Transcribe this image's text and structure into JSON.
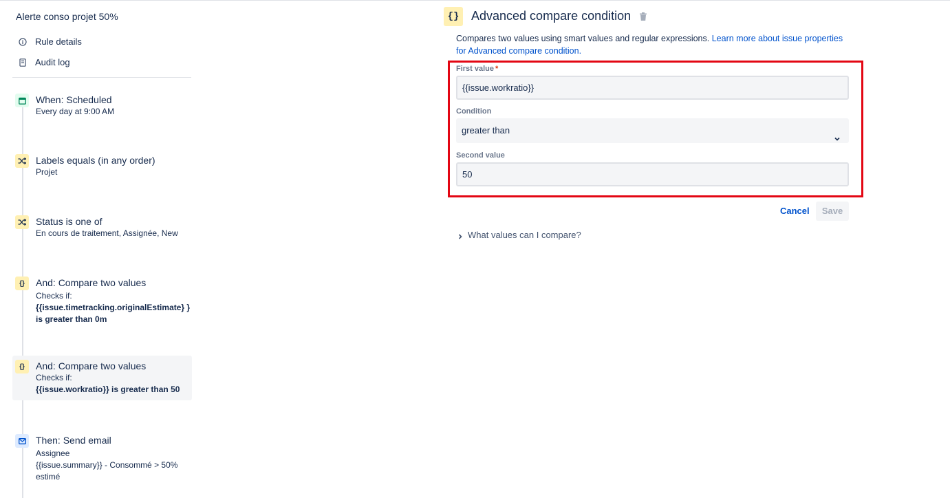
{
  "sidebar": {
    "rule_title": "Alerte conso projet 50%",
    "nav": [
      {
        "label": "Rule details",
        "icon": "info-icon"
      },
      {
        "label": "Audit log",
        "icon": "document-icon"
      }
    ],
    "steps": [
      {
        "icon": "calendar-icon",
        "title": "When: Scheduled",
        "sub": "Every day at 9:00 AM"
      },
      {
        "icon": "shuffle-icon",
        "title": "Labels equals (in any order)",
        "sub": "Projet"
      },
      {
        "icon": "shuffle-icon",
        "title": "Status is one of",
        "sub": "En cours de traitement, Assignée, New"
      },
      {
        "icon": "braces-icon",
        "title": "And: Compare two values",
        "sub": "Checks if:",
        "bold": "{{issue.timetracking.originalEstimate} } is greater than 0m"
      },
      {
        "icon": "braces-icon",
        "title": "And: Compare two values",
        "sub": "Checks if:",
        "bold": "{{issue.workratio}} is greater than 50"
      },
      {
        "icon": "mail-icon",
        "title": "Then: Send email",
        "sub": "Assignee",
        "sub2": "{{issue.summary}} - Consommé > 50% estimé"
      }
    ]
  },
  "panel": {
    "badge": "{}",
    "title": "Advanced compare condition",
    "description": "Compares two values using smart values and regular expressions. ",
    "learn_more": "Learn more about issue properties for Advanced compare condition.",
    "first_value_label": "First value",
    "required_mark": "*",
    "first_value": "{{issue.workratio}}",
    "condition_label": "Condition",
    "condition_value": "greater than",
    "second_value_label": "Second value",
    "second_value": "50",
    "cancel_label": "Cancel",
    "save_label": "Save",
    "expander_label": "What values can I compare?"
  }
}
